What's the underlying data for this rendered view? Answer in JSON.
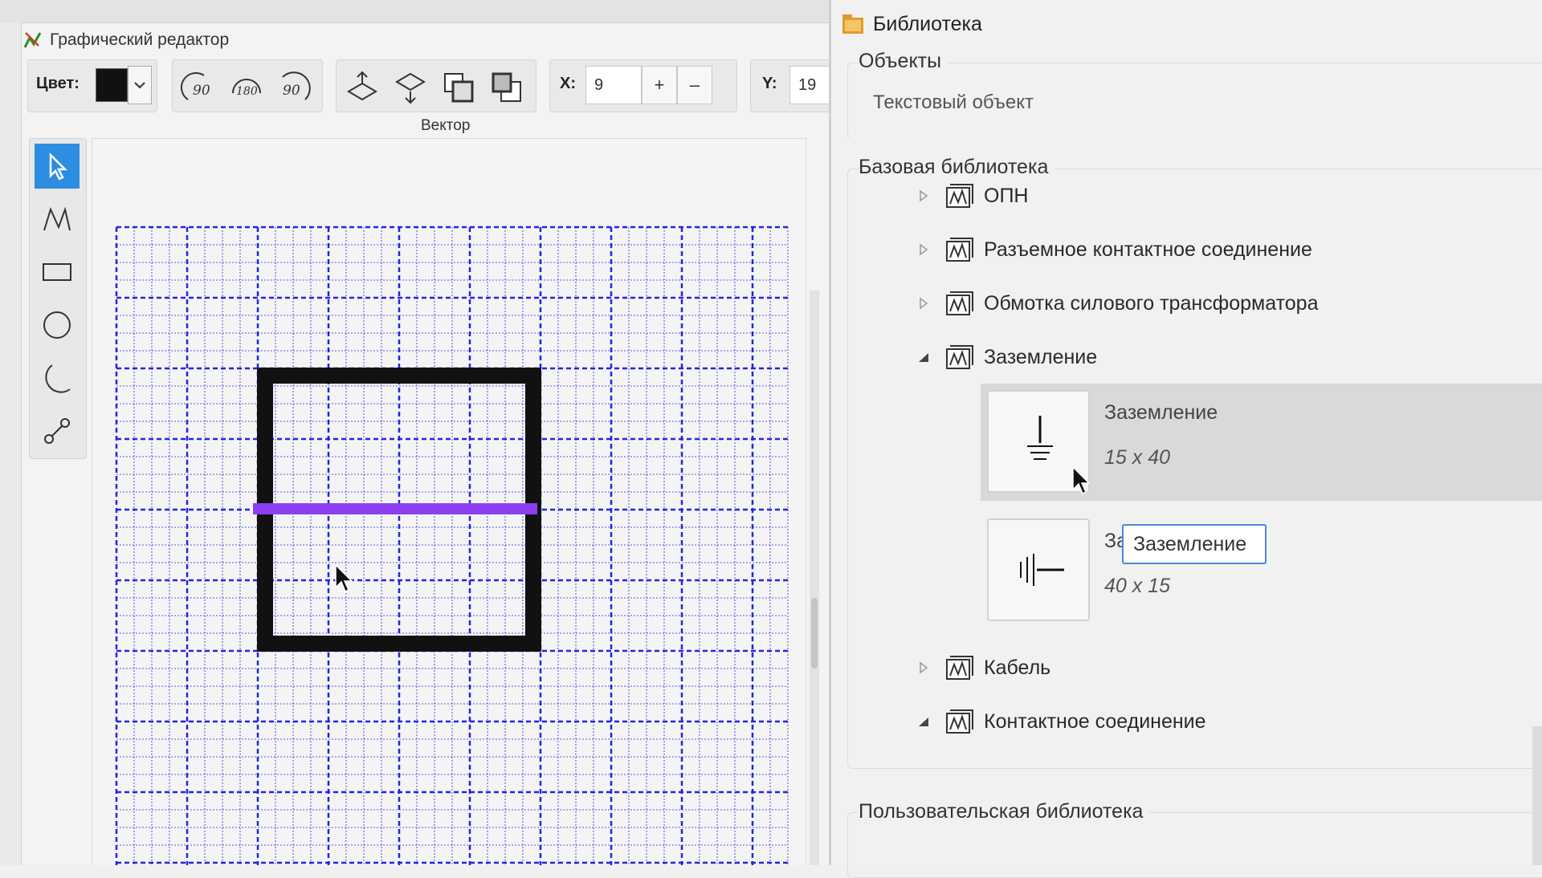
{
  "editor": {
    "title": "Графический редактор",
    "toolbar": {
      "color_label": "Цвет:",
      "color_value": "#111111",
      "rotate_90_left_icon": "rotate-90-ccw-icon",
      "rotate_180_icon": "rotate-180-icon",
      "rotate_90_right_icon": "rotate-90-cw-icon",
      "flip_vertical_icon": "flip-vertical-icon",
      "flip_horizontal_icon": "flip-horizontal-icon",
      "bring_front_icon": "bring-to-front-icon",
      "send_back_icon": "send-to-back-icon",
      "x_label": "X:",
      "x_value": "9",
      "plus": "+",
      "minus": "–",
      "y_label": "Y:",
      "y_value": "19",
      "group_caption": "Вектор"
    },
    "tools": [
      "pointer-icon",
      "polyline-icon",
      "rectangle-icon",
      "circle-icon",
      "arc-icon",
      "connector-icon"
    ],
    "canvas": {
      "shape_color": "#111111",
      "selected_line_color": "#8b3ff0",
      "grid_color": "#2323e6"
    }
  },
  "library": {
    "title": "Библиотека",
    "objects_section": "Объекты",
    "text_object": "Текстовый объект",
    "base_section": "Базовая библиотека",
    "tree": [
      {
        "label": "ОПН",
        "expanded": false
      },
      {
        "label": "Разъемное контактное соединение",
        "expanded": false
      },
      {
        "label": "Обмотка силового трансформатора",
        "expanded": false
      },
      {
        "label": "Заземление",
        "expanded": true
      },
      {
        "label": "Кабель",
        "expanded": false
      },
      {
        "label": "Контактное соединение",
        "expanded": true
      }
    ],
    "items": [
      {
        "name": "Заземление",
        "size": "15 x 40"
      },
      {
        "name": "За",
        "size": "40 x 15"
      }
    ],
    "tooltip": "Заземление",
    "user_section": "Пользовательская библиотека"
  }
}
